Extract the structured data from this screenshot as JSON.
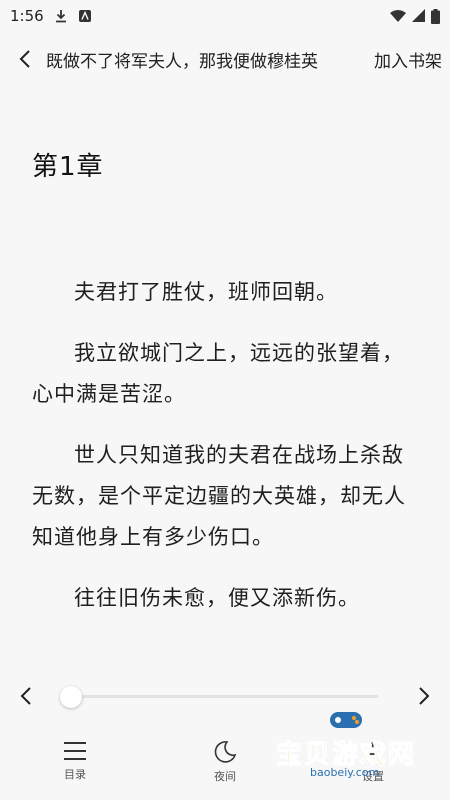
{
  "status_bar": {
    "time": "1:56"
  },
  "header": {
    "book_title": "既做不了将军夫人，那我便做穆桂英",
    "add_shelf": "加入书架"
  },
  "chapter": {
    "title": "第1章",
    "paragraphs": [
      "夫君打了胜仗，班师回朝。",
      "我立欲城门之上，远远的张望着，心中满是苦涩。",
      "世人只知道我的夫君在战场上杀敌无数，是个平定边疆的大英雄，却无人知道他身上有多少伤口。",
      "往往旧伤未愈，便又添新伤。"
    ]
  },
  "progress": {
    "value": 0
  },
  "bottom_bar": {
    "toc": "目录",
    "night": "夜间",
    "settings": "设置"
  },
  "watermark": {
    "text": "宝贝游戏网",
    "url": "baobeiy.com"
  }
}
